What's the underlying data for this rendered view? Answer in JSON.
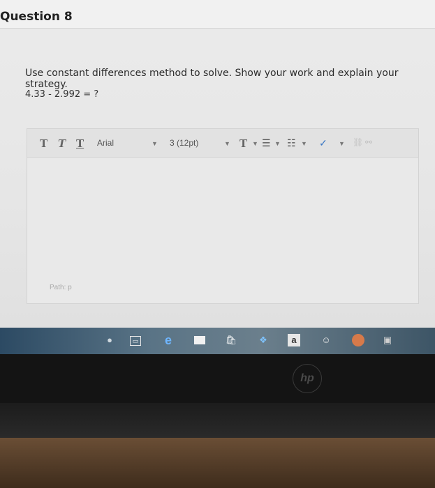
{
  "question": {
    "title": "Question 8",
    "prompt": "Use constant differences method to solve. Show your work and explain your strategy.",
    "expression": "4.33 - 2.992 = ?"
  },
  "editor": {
    "toolbar": {
      "bold_label": "T",
      "italic_label": "T",
      "underline_label": "T",
      "font_family": "Arial",
      "font_size": "3 (12pt)",
      "text_color_label": "T"
    },
    "path_label": "Path: p"
  },
  "taskbar": {
    "amazon_label": "a"
  },
  "device": {
    "brand": "hp"
  }
}
